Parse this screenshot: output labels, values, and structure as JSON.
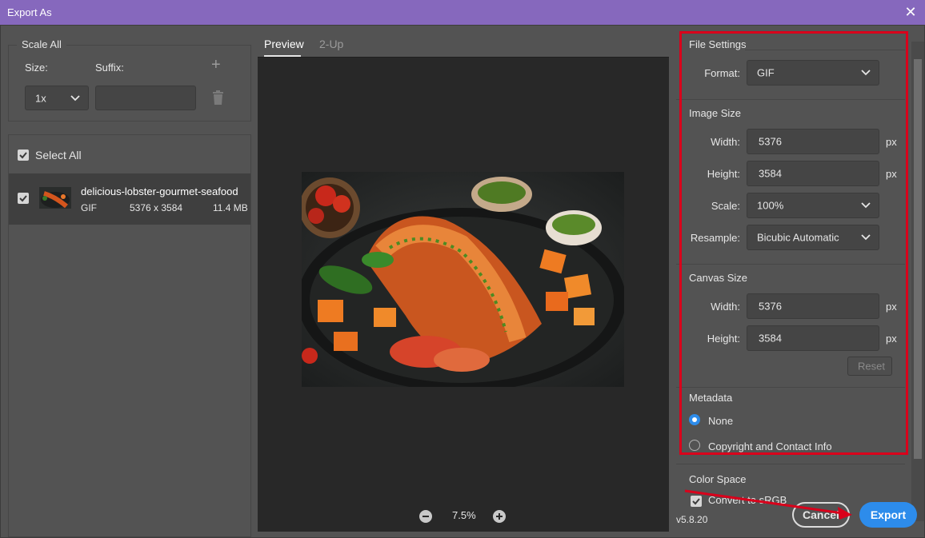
{
  "window": {
    "title": "Export As"
  },
  "left": {
    "scale_all": "Scale All",
    "size_label": "Size:",
    "suffix_label": "Suffix:",
    "size_value": "1x",
    "suffix_value": "",
    "select_all": "Select All",
    "file": {
      "name": "delicious-lobster-gourmet-seafood",
      "format": "GIF",
      "dimensions": "5376 x 3584",
      "size": "11.4 MB"
    }
  },
  "preview": {
    "tabs": [
      "Preview",
      "2-Up"
    ],
    "zoom": "7.5%"
  },
  "right": {
    "file_settings": "File Settings",
    "format_label": "Format:",
    "format_value": "GIF",
    "image_size": "Image Size",
    "width_label": "Width:",
    "width_value": "5376",
    "height_label": "Height:",
    "height_value": "3584",
    "scale_label": "Scale:",
    "scale_value": "100%",
    "resample_label": "Resample:",
    "resample_value": "Bicubic Automatic",
    "unit": "px",
    "canvas_size": "Canvas Size",
    "canvas_width_value": "5376",
    "canvas_height_value": "3584",
    "reset": "Reset",
    "metadata": "Metadata",
    "meta_none": "None",
    "meta_copyright": "Copyright and Contact Info",
    "color_space": "Color Space",
    "convert_srgb": "Convert to sRGB"
  },
  "footer": {
    "version": "v5.8.20",
    "cancel": "Cancel",
    "export": "Export"
  },
  "colors": {
    "accent": "#2d8ceb",
    "annotation": "#d9001b",
    "titlebar": "#8668bd"
  }
}
